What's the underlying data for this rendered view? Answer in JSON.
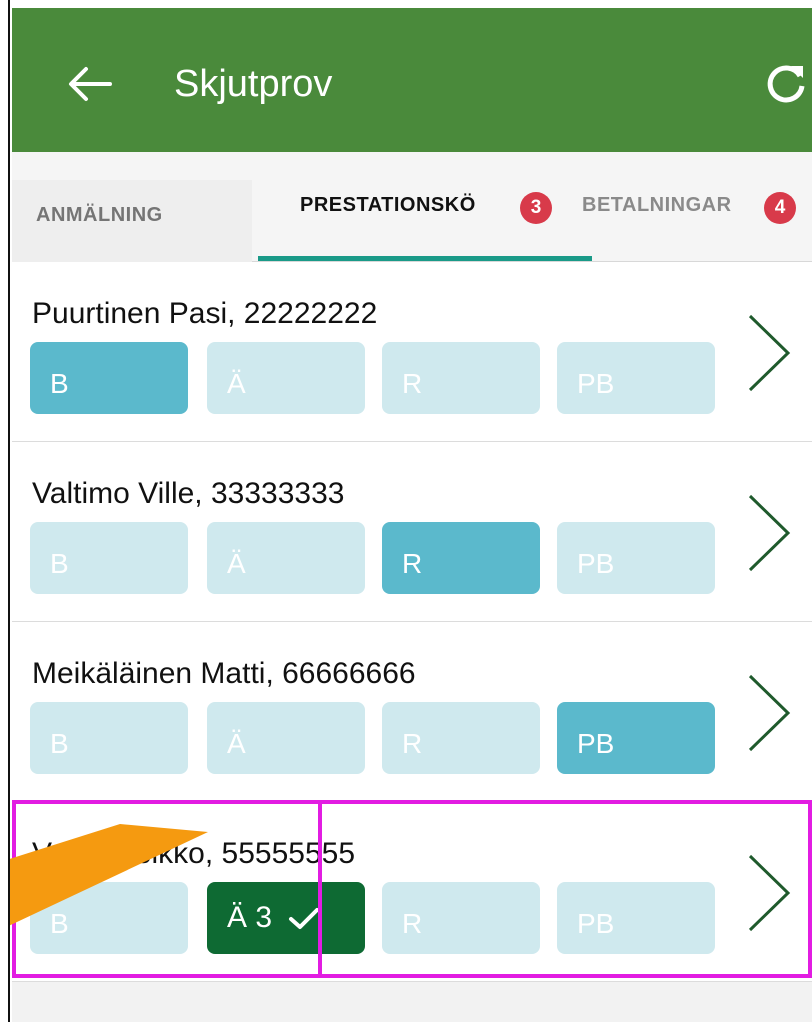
{
  "appbar": {
    "title": "Skjutprov",
    "back_icon": "arrow-left-icon",
    "refresh_icon": "refresh-icon",
    "color": "#4a8a3b"
  },
  "tabs": [
    {
      "label": "ANMÄLNING"
    },
    {
      "label": "PRESTATIONSKÖ",
      "badge": "3",
      "selected": true
    },
    {
      "label": "BETALNINGAR",
      "badge": "4"
    }
  ],
  "rows": [
    {
      "name": "Puurtinen Pasi, 22222222",
      "chips": [
        "B",
        "Ä",
        "R",
        "PB"
      ],
      "active": "B"
    },
    {
      "name": "Valtimo Ville, 33333333",
      "chips": [
        "B",
        "Ä",
        "R",
        "PB"
      ],
      "active": "R"
    },
    {
      "name": "Meikäläinen Matti, 66666666",
      "chips": [
        "B",
        "Ä",
        "R",
        "PB"
      ],
      "active": "PB"
    },
    {
      "name": "Vartio Veikko, 55555555",
      "chips": [
        "B",
        "Ä 3",
        "R",
        "PB"
      ],
      "done": "Ä 3",
      "done_icon": "check-icon"
    }
  ],
  "colors": {
    "chip_inactive": "#cfe9ee",
    "chip_active": "#5bb9cc",
    "chip_done": "#0e6a33",
    "badge": "#d83a4a",
    "highlight": "#e21ce2",
    "pointer": "#f59a10"
  }
}
